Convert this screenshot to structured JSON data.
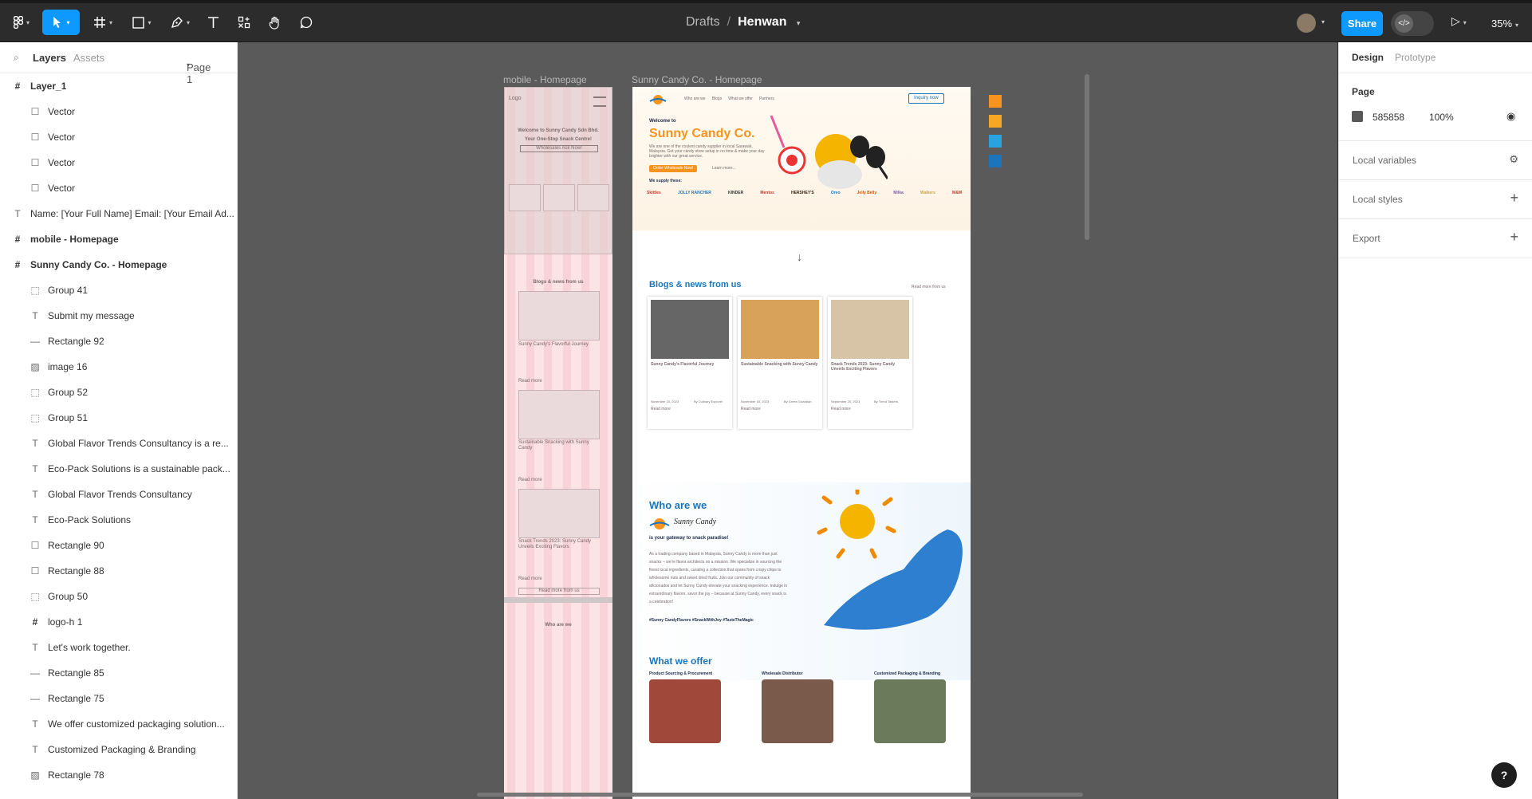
{
  "toolbar": {
    "breadcrumb_root": "Drafts",
    "breadcrumb_sep": "/",
    "file_name": "Henwan",
    "share_label": "Share",
    "zoom": "35%"
  },
  "left_panel": {
    "tab_layers": "Layers",
    "tab_assets": "Assets",
    "page_select": "Page 1",
    "layers": [
      {
        "name": "Layer_1",
        "type": "frame",
        "indent": 0,
        "bold": true
      },
      {
        "name": "Vector",
        "type": "rect",
        "indent": 1
      },
      {
        "name": "Vector",
        "type": "rect",
        "indent": 1
      },
      {
        "name": "Vector",
        "type": "rect",
        "indent": 1
      },
      {
        "name": "Vector",
        "type": "rect",
        "indent": 1
      },
      {
        "name": "Name: [Your Full Name] Email: [Your Email Ad...",
        "type": "text",
        "indent": 0
      },
      {
        "name": "mobile - Homepage",
        "type": "frame",
        "indent": 0,
        "bold": true
      },
      {
        "name": "Sunny Candy Co. - Homepage",
        "type": "frame",
        "indent": 0,
        "bold": true
      },
      {
        "name": "Group 41",
        "type": "group",
        "indent": 1
      },
      {
        "name": "Submit my message",
        "type": "text",
        "indent": 1
      },
      {
        "name": "Rectangle 92",
        "type": "line",
        "indent": 1
      },
      {
        "name": "image 16",
        "type": "image",
        "indent": 1
      },
      {
        "name": "Group 52",
        "type": "group",
        "indent": 1
      },
      {
        "name": "Group 51",
        "type": "group",
        "indent": 1
      },
      {
        "name": "Global Flavor Trends Consultancy is a re...",
        "type": "text",
        "indent": 1
      },
      {
        "name": "Eco-Pack Solutions is a sustainable pack...",
        "type": "text",
        "indent": 1
      },
      {
        "name": "Global Flavor Trends Consultancy",
        "type": "text",
        "indent": 1
      },
      {
        "name": "Eco-Pack Solutions",
        "type": "text",
        "indent": 1
      },
      {
        "name": "Rectangle 90",
        "type": "rect",
        "indent": 1
      },
      {
        "name": "Rectangle 88",
        "type": "rect",
        "indent": 1
      },
      {
        "name": "Group 50",
        "type": "group",
        "indent": 1
      },
      {
        "name": "logo-h 1",
        "type": "frame",
        "indent": 1
      },
      {
        "name": "Let's work together.",
        "type": "text",
        "indent": 1
      },
      {
        "name": "Rectangle 85",
        "type": "line",
        "indent": 1
      },
      {
        "name": "Rectangle 75",
        "type": "line",
        "indent": 1
      },
      {
        "name": "We offer customized packaging solution...",
        "type": "text",
        "indent": 1
      },
      {
        "name": "Customized Packaging & Branding",
        "type": "text",
        "indent": 1
      },
      {
        "name": "Rectangle 78",
        "type": "image",
        "indent": 1
      }
    ]
  },
  "canvas": {
    "mobile_frame_label": "mobile - Homepage",
    "desktop_frame_label": "Sunny Candy Co. - Homepage",
    "mobile": {
      "logo": "Logo",
      "hero_line1": "Welcome to Sunny Candy Sdn Bhd.",
      "hero_line2": "Your One-Stop Snack Centre!",
      "hero_button": "Wholesales Ask Now!",
      "blogs_heading": "Blogs & news from us",
      "card_titles": [
        "Sunny Candy's Flavorful Journey",
        "Sustainable Snacking with Sunny Candy",
        "Snack Trends 2023: Sunny Candy Unveils Exciting Flavors"
      ],
      "read_more": "Read more",
      "read_more_all": "Read more from us",
      "who_heading": "Who are we"
    },
    "desktop": {
      "nav": [
        "Who are we",
        "Blogs",
        "What we offer",
        "Partners"
      ],
      "nav_button": "Inquiry now",
      "welcome": "Welcome to",
      "brand": "Sunny Candy Co.",
      "hero_text": "We are one of the coolest candy supplier in local Sarawak, Malaysia. Get your candy store setup in no time & make your day brighter with our great service.",
      "hero_cta": "Order Wholesale Now!",
      "hero_link": "Learn more...",
      "supply_label": "We supply these:",
      "brands": [
        "Skittles",
        "JOLLY RANCHER",
        "KINDER",
        "Mentos",
        "HERSHEY'S",
        "Oreo",
        "Jelly Belly",
        "Milka",
        "Walkers",
        "M&M"
      ],
      "blogs_heading": "Blogs & news from us",
      "read_more_all": "Read more from us",
      "blog_cards": [
        {
          "title": "Sunny Candy's Flavorful Journey",
          "date": "November 15, 2023",
          "author": "By Culinary Explorer"
        },
        {
          "title": "Sustainable Snacking with Sunny Candy",
          "date": "November 18, 2023",
          "author": "By Green Guardian"
        },
        {
          "title": "Snack Trends 2023: Sunny Candy Unveils Exciting Flavors",
          "date": "September 20, 2023",
          "author": "By Trend Tasters"
        }
      ],
      "read_more": "Read more",
      "who_heading": "Who are we",
      "who_logo": "Sunny Candy",
      "who_tagline": "is your gateway to snack paradise!",
      "who_body": "As a trading company based in Malaysia, Sunny Candy is more than just snacks – we're flavor architects on a mission. We specialize in sourcing the finest local ingredients, curating a collection that spans from crispy chips to wholesome nuts and sweet dried fruits. Join our community of snack aficionados and let Sunny Candy elevate your snacking experience. Indulge in extraordinary flavors, savor the joy – because at Sunny Candy, every snack is a celebration!",
      "who_hashtags": "#Sunny CandyFlavors #SnackWithJoy #TasteTheMagic",
      "offer_heading": "What we offer",
      "offers": [
        "Product Sourcing & Procurement",
        "Wholesale Distributor",
        "Customized Packaging & Branding"
      ]
    },
    "swatches": [
      "#f7941d",
      "#f7a823",
      "#29a3dd",
      "#1b75bc"
    ]
  },
  "right_panel": {
    "tab_design": "Design",
    "tab_prototype": "Prototype",
    "page_label": "Page",
    "page_color": "585858",
    "page_opacity": "100%",
    "sections": [
      "Local variables",
      "Local styles",
      "Export"
    ]
  }
}
